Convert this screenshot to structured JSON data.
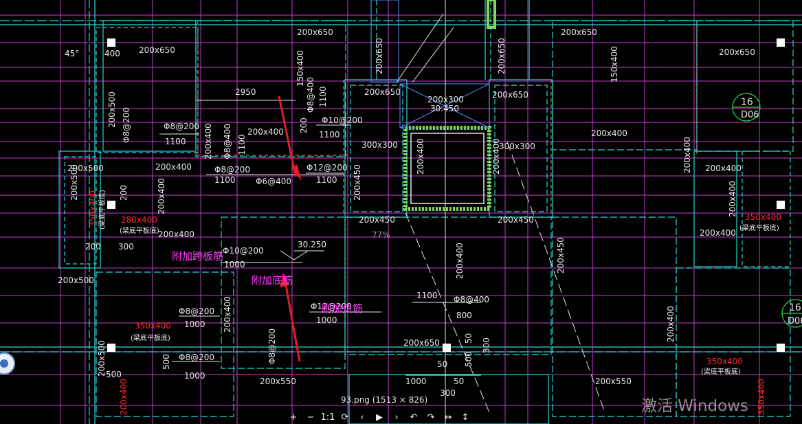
{
  "viewer": {
    "file_caption": "93.png (1513 × 826)",
    "zoom_level": "77%",
    "watermark": "激活 Windows",
    "toolbar": [
      {
        "name": "zoom-in",
        "glyph": "+"
      },
      {
        "name": "zoom-out",
        "glyph": "−"
      },
      {
        "name": "actual-size",
        "glyph": "1:1"
      },
      {
        "name": "fit-window",
        "glyph": "⟳"
      },
      {
        "name": "previous",
        "glyph": "‹"
      },
      {
        "name": "slideshow",
        "glyph": "▶"
      },
      {
        "name": "next",
        "glyph": "›"
      },
      {
        "name": "rotate-left",
        "glyph": "↶"
      },
      {
        "name": "rotate-right",
        "glyph": "↷"
      },
      {
        "name": "flip-horizontal",
        "glyph": "↔"
      },
      {
        "name": "flip-vertical",
        "glyph": "↕"
      }
    ]
  },
  "drawing": {
    "annotations": {
      "additional_span_bar": "附加跨板筋",
      "additional_bottom_bar": "附加底筋",
      "additional_negative_bar": "附加负筋",
      "elevation": "30.250",
      "elevation_2": "30.450",
      "axis_1": "16",
      "axis_1_sub": "D06",
      "axis_2": "16",
      "axis_2_sub": "D06"
    },
    "beams": {
      "b1": "200x650",
      "b2": "200x650",
      "b3": "200x650",
      "b4": "200x650",
      "b5": "200x500",
      "b6": "200x400",
      "b7": "200x400",
      "b8": "200x400",
      "b9": "300x300",
      "b10": "300x300",
      "b11": "200x450",
      "b12": "200x450",
      "b13": "200x500",
      "b14": "200x400",
      "b15": "200x400",
      "b16": "200x550",
      "b17": "200x550",
      "b18": "200x650",
      "b19": "150x400",
      "b20": "200x400",
      "b21": "200x400",
      "b22": "200x650",
      "b23": "200x400",
      "b24": "200x450",
      "b25": "200x400",
      "b26": "200x400",
      "b27": "200x300",
      "b28": "200x650"
    },
    "rebars": {
      "r1": "Φ8@200",
      "r2": "Φ8@200",
      "r3": "Φ6@400",
      "r4": "Φ12@200",
      "r5": "Φ10@200",
      "r6": "Φ10@200",
      "r7": "Φ8@200",
      "r8": "Φ8@200",
      "r9": "Φ8@400",
      "r10": "Φ12@200",
      "r11": "Φ8@400",
      "r12": "Φ8@400"
    },
    "dimensions": {
      "d1": "2950",
      "d2": "1100",
      "d3": "1100",
      "d4": "1100",
      "d5": "1100",
      "d6": "1000",
      "d7": "1000",
      "d8": "1000",
      "d9": "1000",
      "d10": "1000",
      "d11": "1100",
      "d12": "800",
      "d13": "200",
      "d14": "300",
      "d15": "500",
      "d16": "50",
      "d17": "50",
      "d18": "300",
      "d19": "1100",
      "d20": "400"
    },
    "red_labels": {
      "r1": "350x400",
      "r2": "280x400",
      "r3": "350x400",
      "r4": "350x400",
      "r5": "350x400",
      "r6": "200x400"
    },
    "notes": {
      "n1": "(梁底平板底)",
      "n2": "(梁底平板底)",
      "n3": "(梁底平板底)",
      "n4": "(梁底平板底)",
      "n5": "(梁底平板底)"
    },
    "slope_angle": "45°"
  },
  "colors": {
    "background": "#000000",
    "beam_cyan": "#2ad6d6",
    "slab_magenta": "#d83cd8",
    "red_mark": "#ff2a2a",
    "white": "#ffffff",
    "hatch_green": "#7ed957",
    "arrow_red": "#e02020"
  }
}
